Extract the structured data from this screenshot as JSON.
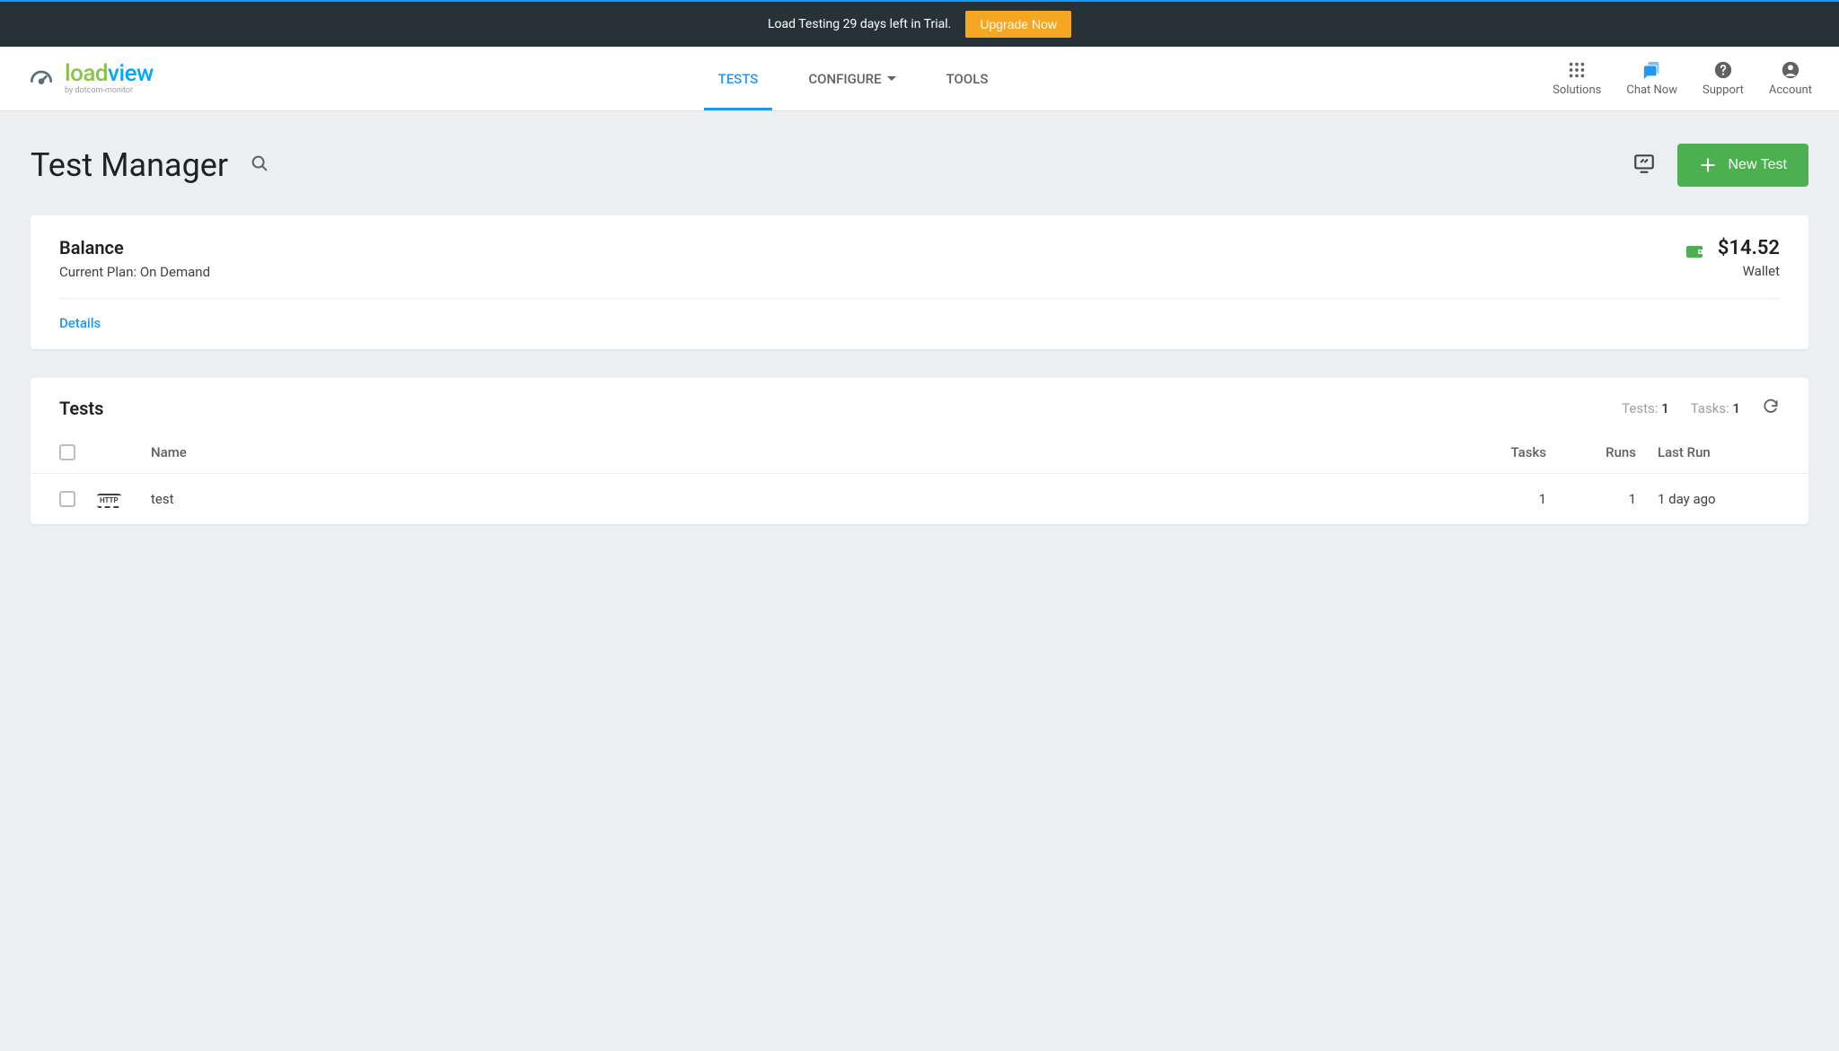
{
  "banner": {
    "message": "Load Testing 29 days left in Trial.",
    "upgrade_label": "Upgrade Now"
  },
  "brand": {
    "name_part1": "load",
    "name_part2": "view",
    "tagline": "by dotcom-monitor"
  },
  "nav": {
    "tests": "TESTS",
    "configure": "CONFIGURE",
    "tools": "TOOLS"
  },
  "header_actions": {
    "solutions": "Solutions",
    "chat_now": "Chat Now",
    "support": "Support",
    "account": "Account"
  },
  "page": {
    "title": "Test Manager",
    "new_test_label": "New Test"
  },
  "balance": {
    "title": "Balance",
    "plan_prefix": "Current Plan: ",
    "plan_name": "On Demand",
    "amount": "$14.52",
    "wallet_label": "Wallet",
    "details_label": "Details"
  },
  "tests_section": {
    "title": "Tests",
    "tests_label": "Tests: ",
    "tests_count": "1",
    "tasks_label": "Tasks: ",
    "tasks_count": "1",
    "columns": {
      "name": "Name",
      "tasks": "Tasks",
      "runs": "Runs",
      "last_run": "Last Run"
    },
    "rows": [
      {
        "icon_label": "HTTP",
        "name": "test",
        "tasks": "1",
        "runs": "1",
        "last_run": "1 day ago"
      }
    ]
  }
}
